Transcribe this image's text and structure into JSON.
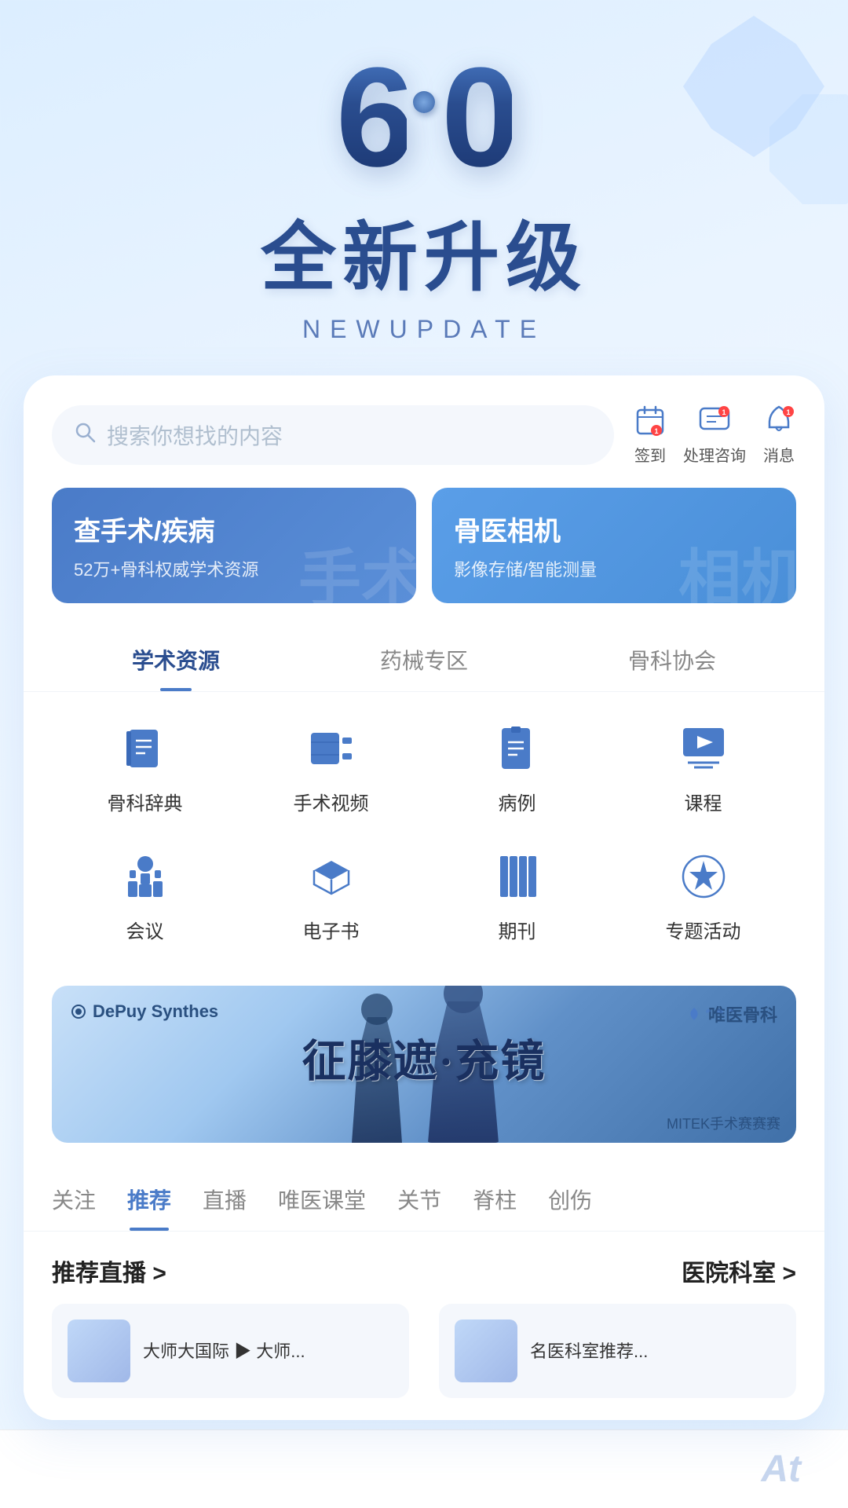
{
  "hero": {
    "version": "6",
    "decimal": "0",
    "title": "全新升级",
    "subtitle": "NEWUPDATE"
  },
  "search": {
    "placeholder": "搜索你想找的内容"
  },
  "header_icons": [
    {
      "id": "checkin",
      "label": "签到",
      "badge": null,
      "icon": "calendar"
    },
    {
      "id": "consult",
      "label": "处理咨询",
      "badge": "1",
      "icon": "chat"
    },
    {
      "id": "message",
      "label": "消息",
      "badge": "1",
      "icon": "bell"
    }
  ],
  "feature_cards": [
    {
      "id": "search-surgery",
      "title": "查手术/疾病",
      "desc": "52万+骨科权威学术资源",
      "bg": "blue",
      "bg_text": "手术"
    },
    {
      "id": "bone-camera",
      "title": "骨医相机",
      "desc": "影像存储/智能测量",
      "bg": "light-blue",
      "bg_text": "相机"
    }
  ],
  "tabs": [
    {
      "id": "academic",
      "label": "学术资源",
      "active": true
    },
    {
      "id": "pharma",
      "label": "药械专区",
      "active": false
    },
    {
      "id": "association",
      "label": "骨科协会",
      "active": false
    }
  ],
  "grid_items": [
    {
      "id": "dictionary",
      "label": "骨科辞典",
      "icon": "book"
    },
    {
      "id": "video",
      "label": "手术视频",
      "icon": "video"
    },
    {
      "id": "cases",
      "label": "病例",
      "icon": "document"
    },
    {
      "id": "courses",
      "label": "课程",
      "icon": "play"
    },
    {
      "id": "meeting",
      "label": "会议",
      "icon": "podium"
    },
    {
      "id": "ebook",
      "label": "电子书",
      "icon": "book2"
    },
    {
      "id": "journal",
      "label": "期刊",
      "icon": "journal"
    },
    {
      "id": "special",
      "label": "专题活动",
      "icon": "star"
    }
  ],
  "banner": {
    "left_brand": "DePuy Synthes",
    "right_brand": "唯医骨科",
    "title_cn": "征膝遮·充镜",
    "subtitle": "MITEK手术赛赛赛"
  },
  "content_tabs": [
    {
      "id": "follow",
      "label": "关注",
      "active": false
    },
    {
      "id": "recommend",
      "label": "推荐",
      "active": true
    },
    {
      "id": "live",
      "label": "直播",
      "active": false
    },
    {
      "id": "classroom",
      "label": "唯医课堂",
      "active": false
    },
    {
      "id": "joint",
      "label": "关节",
      "active": false
    },
    {
      "id": "spine",
      "label": "脊柱",
      "active": false
    },
    {
      "id": "trauma",
      "label": "创伤",
      "active": false
    }
  ],
  "bottom_sections": {
    "live": {
      "title": "推荐直播 >",
      "more": ""
    },
    "hospital": {
      "title": "医院科室 >",
      "more": ""
    }
  },
  "bottom_tab_bar": {
    "at_icon": "At"
  }
}
